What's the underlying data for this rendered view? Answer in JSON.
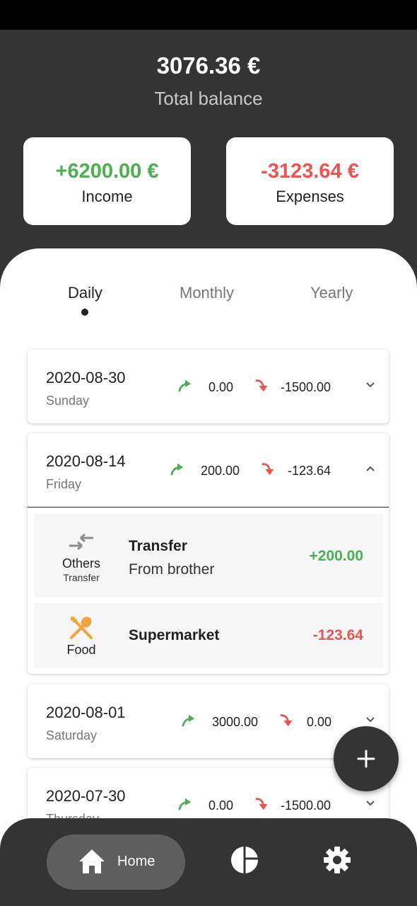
{
  "header": {
    "total_balance": "3076.36 €",
    "total_balance_label": "Total balance",
    "income_amount": "+6200.00 €",
    "income_label": "Income",
    "expenses_amount": "-3123.64 €",
    "expenses_label": "Expenses"
  },
  "tabs": [
    "Daily",
    "Monthly",
    "Yearly"
  ],
  "days": [
    {
      "date": "2020-08-30",
      "weekday": "Sunday",
      "income": "0.00",
      "expense": "-1500.00"
    },
    {
      "date": "2020-08-14",
      "weekday": "Friday",
      "income": "200.00",
      "expense": "-123.64"
    },
    {
      "date": "2020-08-01",
      "weekday": "Saturday",
      "income": "3000.00",
      "expense": "0.00"
    },
    {
      "date": "2020-07-30",
      "weekday": "Thursday",
      "income": "0.00",
      "expense": "-1500.00"
    }
  ],
  "transactions": [
    {
      "category": "Others",
      "subcategory": "Transfer",
      "title": "Transfer",
      "description": "From brother",
      "amount": "+200.00"
    },
    {
      "category": "Food",
      "title": "Supermarket",
      "amount": "-123.64"
    }
  ],
  "nav": {
    "home_label": "Home"
  },
  "colors": {
    "income": "#4caf50",
    "expense": "#ef5350",
    "dark": "#343434"
  },
  "icons": {
    "income": "trend-up-arrow-icon",
    "expense": "trend-down-arrow-icon",
    "others": "transfer-arrows-icon",
    "food": "fork-spoon-icon",
    "fab": "plus-icon",
    "home": "home-icon",
    "stats": "pie-chart-icon",
    "settings": "gear-icon"
  }
}
